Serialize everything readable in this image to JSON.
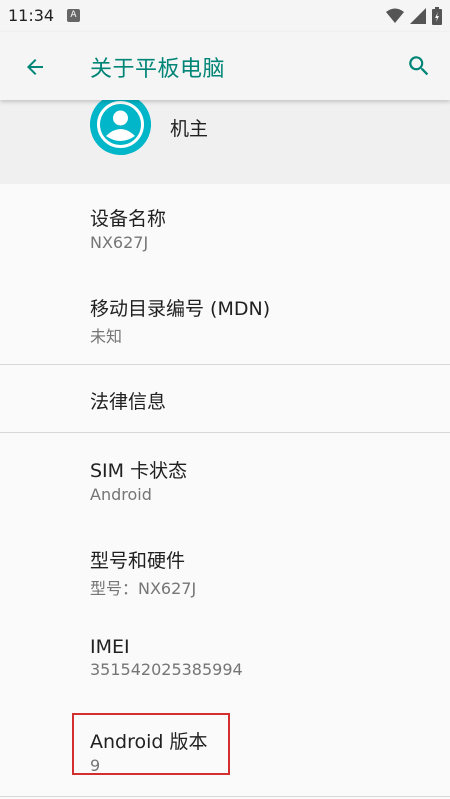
{
  "status": {
    "time": "11:34",
    "notif_letter": "A"
  },
  "appbar": {
    "title": "关于平板电脑"
  },
  "user": {
    "name": "机主"
  },
  "items": [
    {
      "title": "设备名称",
      "subtitle": "NX627J"
    },
    {
      "title": "移动目录编号 (MDN)",
      "subtitle": "未知"
    },
    {
      "title": "法律信息"
    },
    {
      "title": "SIM 卡状态",
      "subtitle": "Android"
    },
    {
      "title": "型号和硬件",
      "subtitle": "型号：NX627J"
    },
    {
      "title": "IMEI",
      "subtitle": "351542025385994"
    },
    {
      "title": "Android 版本",
      "subtitle": "9"
    }
  ],
  "colors": {
    "accent": "#008577",
    "avatar": "#00b6c8",
    "highlight": "#d32f2f"
  }
}
